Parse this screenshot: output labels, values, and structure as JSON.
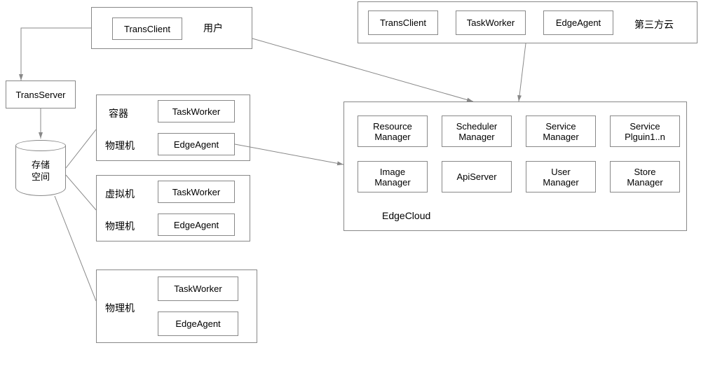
{
  "user": {
    "label": "用户",
    "trans_client": "TransClient"
  },
  "third_party": {
    "label": "第三方云",
    "trans_client": "TransClient",
    "task_worker": "TaskWorker",
    "edge_agent": "EdgeAgent"
  },
  "trans_server": "TransServer",
  "storage": "存储\n空间",
  "nodes": {
    "group1": {
      "row1_label": "容器",
      "row1_box": "TaskWorker",
      "row2_label": "物理机",
      "row2_box": "EdgeAgent"
    },
    "group2": {
      "row1_label": "虚拟机",
      "row1_box": "TaskWorker",
      "row2_label": "物理机",
      "row2_box": "EdgeAgent"
    },
    "group3": {
      "label": "物理机",
      "box1": "TaskWorker",
      "box2": "EdgeAgent"
    }
  },
  "edge_cloud": {
    "label": "EdgeCloud",
    "items": [
      "Resource\nManager",
      "Scheduler\nManager",
      "Service\nManager",
      "Service\nPlguin1..n",
      "Image\nManager",
      "ApiServer",
      "User\nManager",
      "Store\nManager"
    ]
  }
}
